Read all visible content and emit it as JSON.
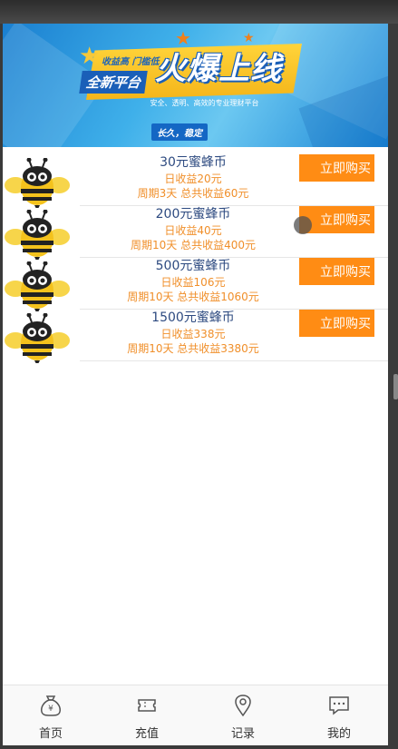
{
  "banner": {
    "small_tag": "收益高 门槛低",
    "new_platform": "全新平台",
    "headline": "火爆上线",
    "subline": "安全、透明、高效的专业理财平台",
    "pill": "长久，稳定"
  },
  "products": [
    {
      "name": "30元蜜蜂币",
      "daily": "日收益20元",
      "total": "周期3天 总共收益60元",
      "button": "立即购买"
    },
    {
      "name": "200元蜜蜂币",
      "daily": "日收益40元",
      "total": "周期10天 总共收益400元",
      "button": "立即购买"
    },
    {
      "name": "500元蜜蜂币",
      "daily": "日收益106元",
      "total": "周期10天 总共收益1060元",
      "button": "立即购买"
    },
    {
      "name": "1500元蜜蜂币",
      "daily": "日收益338元",
      "total": "周期10天 总共收益3380元",
      "button": "立即购买"
    }
  ],
  "nav": {
    "home": "首页",
    "recharge": "充值",
    "records": "记录",
    "mine": "我的"
  },
  "colors": {
    "buy_button": "#ff8c14",
    "product_name": "#2d4a80",
    "earnings_text": "#f08f2a",
    "banner_blue": "#1a7fd0"
  }
}
